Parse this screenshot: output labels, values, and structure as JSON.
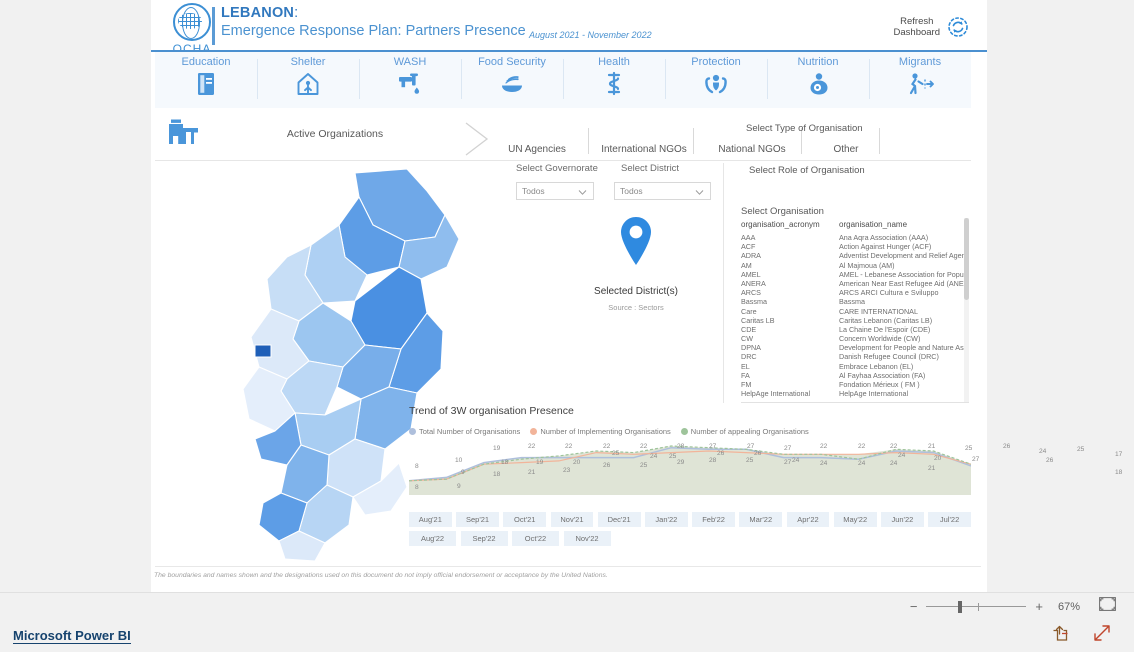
{
  "header": {
    "org": "OCHA",
    "country": "LEBANON",
    "colon": ":",
    "subtitle": "Emergence Response Plan: Partners Presence",
    "period": "August 2021 - November 2022",
    "refresh_line1": "Refresh",
    "refresh_line2": "Dashboard",
    "refresh_icon": "refresh-icon",
    "logo_icon": "ocha-un-globe-icon"
  },
  "sectors": [
    {
      "label": "Education",
      "icon": "book-icon"
    },
    {
      "label": "Shelter",
      "icon": "shelter-person-house-icon"
    },
    {
      "label": "WASH",
      "icon": "faucet-water-drop-icon"
    },
    {
      "label": "Food Security",
      "icon": "bowl-wheat-icon"
    },
    {
      "label": "Health",
      "icon": "asclepius-rod-icon"
    },
    {
      "label": "Protection",
      "icon": "hands-person-icon"
    },
    {
      "label": "Nutrition",
      "icon": "breastfeeding-icon"
    },
    {
      "label": "Migrants",
      "icon": "walking-migrant-icon"
    }
  ],
  "tabbar": {
    "icon": "buildings-organization-icon",
    "active": "Active Organizations",
    "chevron_icon": "chevron-right-icon",
    "tabs": [
      "UN Agencies",
      "International NGOs",
      "National NGOs",
      "Other"
    ]
  },
  "filters": {
    "governorate_label": "Select  Governorate",
    "governorate_value": "Todos",
    "district_label": "Select District",
    "district_value": "Todos",
    "chevron_icon": "chevron-down-icon"
  },
  "map": {
    "pin_icon": "map-pin-icon",
    "title": "Selected District(s)",
    "source": "Source : Sectors"
  },
  "org_panel": {
    "type_label": "Select Type of Organisation",
    "role_label": "Select Role of Organisation",
    "org_label": "Select Organisation",
    "col_acronym": "organisation_acronym",
    "col_name": "organisation_name",
    "rows": [
      {
        "acronym": "AAA",
        "name": "Ana Aqra Association (AAA)"
      },
      {
        "acronym": "ACF",
        "name": "Action Against Hunger (ACF)"
      },
      {
        "acronym": "ADRA",
        "name": "Adventist Development and Relief Agenc"
      },
      {
        "acronym": "AM",
        "name": "Al Majmoua (AM)"
      },
      {
        "acronym": "AMEL",
        "name": "AMEL - Lebanese Association for Popula"
      },
      {
        "acronym": "ANERA",
        "name": "American Near East Refugee Aid (ANER"
      },
      {
        "acronym": "ARCS",
        "name": "ARCS ARCI Cultura e Sviluppo"
      },
      {
        "acronym": "Bassma",
        "name": "Bassma"
      },
      {
        "acronym": "Care",
        "name": "CARE INTERNATIONAL"
      },
      {
        "acronym": "Caritas LB",
        "name": "Caritas Lebanon (Caritas LB)"
      },
      {
        "acronym": "CDE",
        "name": "La Chaine De l'Espoir (CDE)"
      },
      {
        "acronym": "CW",
        "name": "Concern Worldwide (CW)"
      },
      {
        "acronym": "DPNA",
        "name": "Development for People and Nature Ass"
      },
      {
        "acronym": "DRC",
        "name": "Danish Refugee Council (DRC)"
      },
      {
        "acronym": "EL",
        "name": "Embrace Lebanon (EL)"
      },
      {
        "acronym": "FA",
        "name": "Al Fayhaa Association (FA)"
      },
      {
        "acronym": "FM",
        "name": "Fondation Mérieux ( FM )"
      },
      {
        "acronym": "HelpAge International",
        "name": "HelpAge International"
      }
    ]
  },
  "chart_data": {
    "type": "area",
    "title": "Trend of 3W organisation Presence",
    "xlabel": "",
    "ylabel": "",
    "grid": false,
    "legend_position": "top",
    "categories": [
      "Aug'21",
      "Sep'21",
      "Oct'21",
      "Nov'21",
      "Dec'21",
      "Jan'22",
      "Feb'22",
      "Mar'22",
      "Apr'22",
      "May'22",
      "Jun'22",
      "Jul'22",
      "Aug'22",
      "Sep'22",
      "Oct'22",
      "Nov'22"
    ],
    "series": [
      {
        "name": "Total Number of Organisations",
        "color": "#aebfdc",
        "values": [
          8,
          10,
          19,
          22,
          22,
          22,
          22,
          28,
          27,
          27,
          22,
          22,
          21,
          26,
          25,
          17
        ]
      },
      {
        "name": "Number of Implementing Organisations",
        "color": "#f2b49a",
        "values": [
          8,
          9,
          18,
          19,
          20,
          25,
          24,
          25,
          26,
          25,
          24,
          24,
          24,
          25,
          24,
          18
        ]
      },
      {
        "name": "Number of appealing Organisations",
        "color": "#9ec49b",
        "values": [
          8,
          9,
          18,
          21,
          23,
          26,
          25,
          29,
          28,
          27,
          24,
          24,
          21,
          27,
          26,
          18
        ]
      }
    ],
    "point_labels": [
      {
        "text": "8",
        "x": 6,
        "y": 20,
        "series": 0
      },
      {
        "text": "8",
        "x": 6,
        "y": 41,
        "series": 1
      },
      {
        "text": "10",
        "x": 46,
        "y": 14,
        "series": 0
      },
      {
        "text": "9",
        "x": 52,
        "y": 26,
        "series": 1
      },
      {
        "text": "9",
        "x": 48,
        "y": 40,
        "series": 2
      },
      {
        "text": "19",
        "x": 84,
        "y": 2,
        "series": 0
      },
      {
        "text": "18",
        "x": 92,
        "y": 16,
        "series": 1
      },
      {
        "text": "18",
        "x": 84,
        "y": 28,
        "series": 2
      },
      {
        "text": "22",
        "x": 119,
        "y": 0,
        "series": 0
      },
      {
        "text": "19",
        "x": 127,
        "y": 16,
        "series": 1
      },
      {
        "text": "21",
        "x": 119,
        "y": 26,
        "series": 2
      },
      {
        "text": "22",
        "x": 156,
        "y": 0,
        "series": 0
      },
      {
        "text": "20",
        "x": 164,
        "y": 16,
        "series": 1
      },
      {
        "text": "23",
        "x": 154,
        "y": 24,
        "series": 2
      },
      {
        "text": "22",
        "x": 194,
        "y": 0,
        "series": 0
      },
      {
        "text": "25",
        "x": 203,
        "y": 7,
        "series": 1
      },
      {
        "text": "26",
        "x": 194,
        "y": 19,
        "series": 2
      },
      {
        "text": "22",
        "x": 231,
        "y": 0,
        "series": 0
      },
      {
        "text": "24",
        "x": 241,
        "y": 10,
        "series": 1
      },
      {
        "text": "25",
        "x": 231,
        "y": 19,
        "series": 2
      },
      {
        "text": "28",
        "x": 268,
        "y": 0,
        "series": 0
      },
      {
        "text": "25",
        "x": 260,
        "y": 10,
        "series": 1
      },
      {
        "text": "29",
        "x": 268,
        "y": 16,
        "series": 2
      },
      {
        "text": "27",
        "x": 300,
        "y": 0,
        "series": 0
      },
      {
        "text": "26",
        "x": 308,
        "y": 7,
        "series": 1
      },
      {
        "text": "28",
        "x": 300,
        "y": 14,
        "series": 2
      },
      {
        "text": "27",
        "x": 338,
        "y": 0,
        "series": 0
      },
      {
        "text": "26",
        "x": 345,
        "y": 7,
        "series": 1
      },
      {
        "text": "25",
        "x": 337,
        "y": 14,
        "series": 2
      },
      {
        "text": "27",
        "x": 375,
        "y": 2,
        "series": 0
      },
      {
        "text": "24",
        "x": 383,
        "y": 14,
        "series": 1
      },
      {
        "text": "27",
        "x": 375,
        "y": 16,
        "series": 2
      },
      {
        "text": "22",
        "x": 411,
        "y": 0,
        "series": 0
      },
      {
        "text": "24",
        "x": 411,
        "y": 17,
        "series": 1
      },
      {
        "text": "22",
        "x": 449,
        "y": 0,
        "series": 0
      },
      {
        "text": "24",
        "x": 449,
        "y": 17,
        "series": 1
      },
      {
        "text": "22",
        "x": 481,
        "y": 0,
        "series": 0
      },
      {
        "text": "24",
        "x": 489,
        "y": 9,
        "series": 1
      },
      {
        "text": "24",
        "x": 481,
        "y": 17,
        "series": 2
      },
      {
        "text": "21",
        "x": 519,
        "y": 0,
        "series": 0
      },
      {
        "text": "20",
        "x": 525,
        "y": 12,
        "series": 1
      },
      {
        "text": "21",
        "x": 519,
        "y": 22,
        "series": 2
      },
      {
        "text": "25",
        "x": 556,
        "y": 2,
        "series": 0
      },
      {
        "text": "27",
        "x": 563,
        "y": 13,
        "series": 1
      },
      {
        "text": "26",
        "x": 594,
        "y": 0,
        "series": 2
      },
      {
        "text": "24",
        "x": 630,
        "y": 5,
        "series": 0
      },
      {
        "text": "26",
        "x": 637,
        "y": 14,
        "series": 1
      },
      {
        "text": "25",
        "x": 668,
        "y": 3,
        "series": 2
      },
      {
        "text": "17",
        "x": 706,
        "y": 8,
        "series": 0
      },
      {
        "text": "18",
        "x": 706,
        "y": 26,
        "series": 1
      }
    ]
  },
  "months_row1": [
    "Aug'21",
    "Sep'21",
    "Oct'21",
    "Nov'21",
    "Dec'21",
    "Jan'22",
    "Feb'22",
    "Mar'22",
    "Apr'22",
    "May'22",
    "Jun'22",
    "Jul'22"
  ],
  "months_row2": [
    "Aug'22",
    "Sep'22",
    "Oct'22",
    "Nov'22"
  ],
  "footnote": "The boundaries and names shown and the designations used on this document do not imply official endorsement or acceptance by the United Nations.",
  "statusbar": {
    "minus": "−",
    "plus": "+",
    "zoom": "67%",
    "fit_icon": "fit-to-page-icon"
  },
  "powerbi": {
    "brand": "Microsoft Power BI",
    "share_icon": "share-icon",
    "fullscreen_icon": "fullscreen-icon"
  },
  "colors": {
    "brand_blue": "#4b90d0",
    "title_blue": "#3178be",
    "series_total": "#aebfdc",
    "series_implementing": "#f2b49a",
    "series_appealing": "#9ec49b",
    "chip_bg": "#eaf1f8",
    "pbi_brand": "#16436e"
  }
}
